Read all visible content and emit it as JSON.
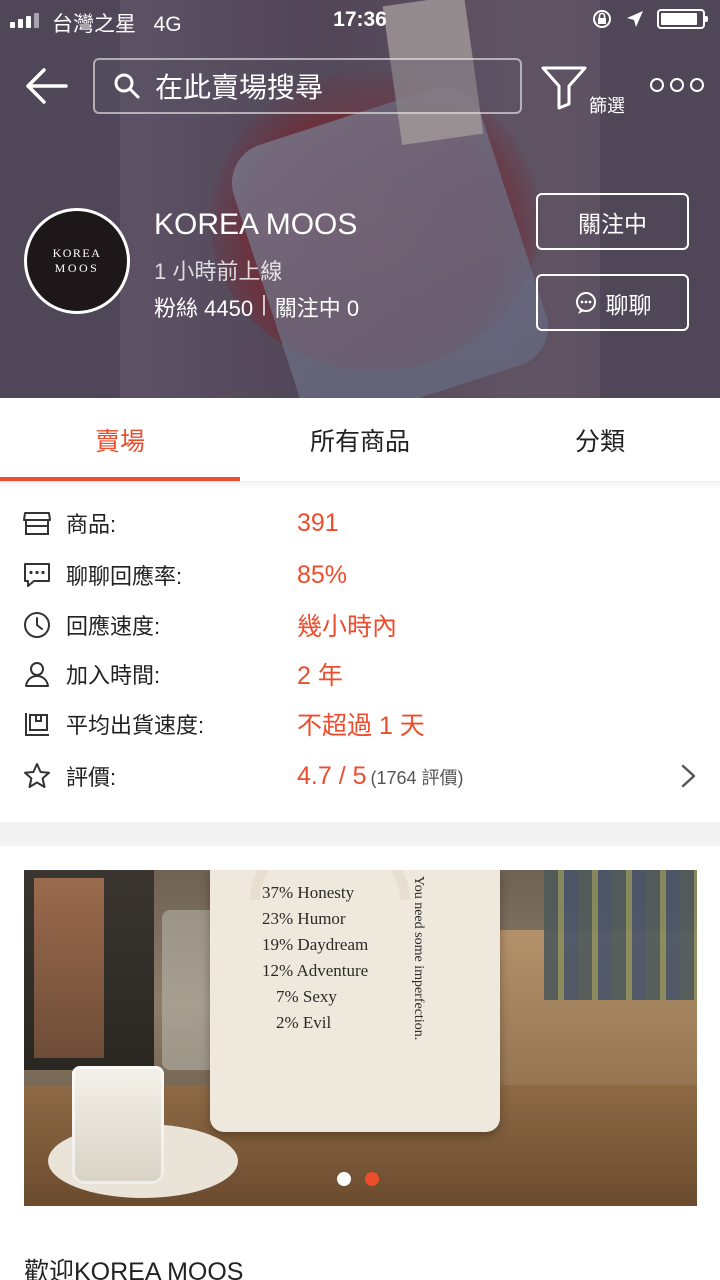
{
  "status_bar": {
    "carrier": "台灣之星",
    "network": "4G",
    "time": "17:36"
  },
  "nav": {
    "search_placeholder": "在此賣場搜尋",
    "filter_label": "篩選"
  },
  "shop": {
    "avatar_line1": "KOREA",
    "avatar_line2": "MOOS",
    "name": "KOREA MOOS",
    "last_online": "1 小時前上線",
    "followers": "粉絲 4450",
    "separator": "|",
    "following": "關注中 0",
    "follow_button": "關注中",
    "chat_button": "聊聊"
  },
  "tabs": [
    {
      "label": "賣場",
      "active": true
    },
    {
      "label": "所有商品",
      "active": false
    },
    {
      "label": "分類",
      "active": false
    }
  ],
  "info_rows": [
    {
      "icon": "store-icon",
      "label": "商品:",
      "value": "391"
    },
    {
      "icon": "chat-bubble-icon",
      "label": "聊聊回應率:",
      "value": "85%"
    },
    {
      "icon": "clock-icon",
      "label": "回應速度:",
      "value": "幾小時內"
    },
    {
      "icon": "user-icon",
      "label": "加入時間:",
      "value": "2 年"
    },
    {
      "icon": "shipping-box-icon",
      "label": "平均出貨速度:",
      "value": "不超過 1 天"
    },
    {
      "icon": "star-icon",
      "label": "評價:",
      "value": "4.7 / 5",
      "extra": "(1764 評價)"
    }
  ],
  "banner": {
    "bag_lines": [
      "37% Honesty",
      "23% Humor",
      "19% Daydream",
      "12% Adventure",
      "7% Sexy",
      "2% Evil"
    ],
    "bag_side_text": "You need some imperfection.",
    "slide_count": 2,
    "active_slide": 2
  },
  "welcome": "歡迎KOREA MOOS",
  "colors": {
    "accent": "#ee4d2d",
    "text": "#222222",
    "divider": "#f3f3f3"
  }
}
